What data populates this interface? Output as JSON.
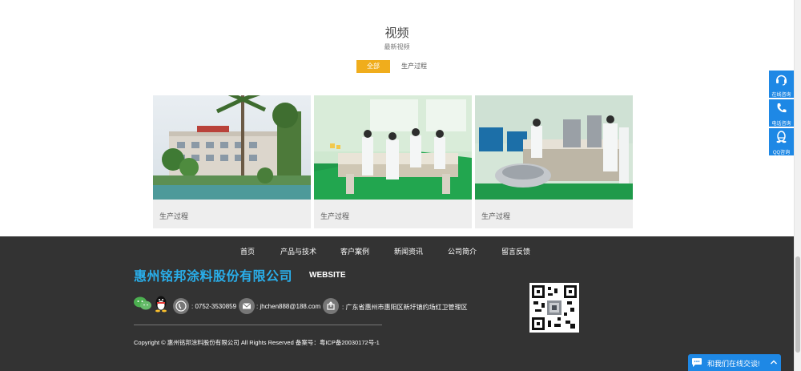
{
  "section": {
    "title": "视频",
    "subtitle": "最新视频"
  },
  "tabs": [
    {
      "label": "全部",
      "active": true
    },
    {
      "label": "生产过程",
      "active": false
    }
  ],
  "cards": [
    {
      "label": "生产过程"
    },
    {
      "label": "生产过程"
    },
    {
      "label": "生产过程"
    }
  ],
  "footer": {
    "nav": [
      "首页",
      "产品与技术",
      "客户案例",
      "新闻资讯",
      "公司简介",
      "留言反馈"
    ],
    "company_name": "惠州铭邦涂料股份有限公司",
    "website_label": "WEBSITE",
    "phone": ": 0752-3530859",
    "email": ": jhchen888@188.com",
    "address": ": 广东省惠州市惠阳区新圩镇约场红卫管理区",
    "copyright": "Copyright © 惠州铭邦涂料股份有限公司 All Rights Reserved 备案号：粤ICP备20030172号-1"
  },
  "side_panel": [
    {
      "label": "在线咨询",
      "icon": "headset-icon"
    },
    {
      "label": "电话咨询",
      "icon": "phone-icon"
    },
    {
      "label": "QQ咨询",
      "icon": "qq-icon"
    }
  ],
  "chat_bar": {
    "label": "和我们在线交谈!"
  },
  "colors": {
    "accent": "#f0ad1c",
    "footer_bg": "#333333",
    "brand_blue": "#29aeea",
    "side_blue": "#1e88e5"
  }
}
